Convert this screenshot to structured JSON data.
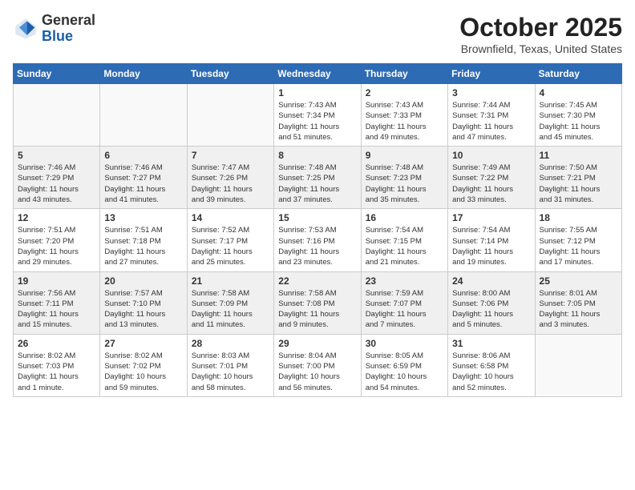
{
  "header": {
    "logo_general": "General",
    "logo_blue": "Blue",
    "month_title": "October 2025",
    "location": "Brownfield, Texas, United States"
  },
  "weekdays": [
    "Sunday",
    "Monday",
    "Tuesday",
    "Wednesday",
    "Thursday",
    "Friday",
    "Saturday"
  ],
  "weeks": [
    [
      {
        "day": null,
        "info": null
      },
      {
        "day": null,
        "info": null
      },
      {
        "day": null,
        "info": null
      },
      {
        "day": "1",
        "info": "Sunrise: 7:43 AM\nSunset: 7:34 PM\nDaylight: 11 hours\nand 51 minutes."
      },
      {
        "day": "2",
        "info": "Sunrise: 7:43 AM\nSunset: 7:33 PM\nDaylight: 11 hours\nand 49 minutes."
      },
      {
        "day": "3",
        "info": "Sunrise: 7:44 AM\nSunset: 7:31 PM\nDaylight: 11 hours\nand 47 minutes."
      },
      {
        "day": "4",
        "info": "Sunrise: 7:45 AM\nSunset: 7:30 PM\nDaylight: 11 hours\nand 45 minutes."
      }
    ],
    [
      {
        "day": "5",
        "info": "Sunrise: 7:46 AM\nSunset: 7:29 PM\nDaylight: 11 hours\nand 43 minutes."
      },
      {
        "day": "6",
        "info": "Sunrise: 7:46 AM\nSunset: 7:27 PM\nDaylight: 11 hours\nand 41 minutes."
      },
      {
        "day": "7",
        "info": "Sunrise: 7:47 AM\nSunset: 7:26 PM\nDaylight: 11 hours\nand 39 minutes."
      },
      {
        "day": "8",
        "info": "Sunrise: 7:48 AM\nSunset: 7:25 PM\nDaylight: 11 hours\nand 37 minutes."
      },
      {
        "day": "9",
        "info": "Sunrise: 7:48 AM\nSunset: 7:23 PM\nDaylight: 11 hours\nand 35 minutes."
      },
      {
        "day": "10",
        "info": "Sunrise: 7:49 AM\nSunset: 7:22 PM\nDaylight: 11 hours\nand 33 minutes."
      },
      {
        "day": "11",
        "info": "Sunrise: 7:50 AM\nSunset: 7:21 PM\nDaylight: 11 hours\nand 31 minutes."
      }
    ],
    [
      {
        "day": "12",
        "info": "Sunrise: 7:51 AM\nSunset: 7:20 PM\nDaylight: 11 hours\nand 29 minutes."
      },
      {
        "day": "13",
        "info": "Sunrise: 7:51 AM\nSunset: 7:18 PM\nDaylight: 11 hours\nand 27 minutes."
      },
      {
        "day": "14",
        "info": "Sunrise: 7:52 AM\nSunset: 7:17 PM\nDaylight: 11 hours\nand 25 minutes."
      },
      {
        "day": "15",
        "info": "Sunrise: 7:53 AM\nSunset: 7:16 PM\nDaylight: 11 hours\nand 23 minutes."
      },
      {
        "day": "16",
        "info": "Sunrise: 7:54 AM\nSunset: 7:15 PM\nDaylight: 11 hours\nand 21 minutes."
      },
      {
        "day": "17",
        "info": "Sunrise: 7:54 AM\nSunset: 7:14 PM\nDaylight: 11 hours\nand 19 minutes."
      },
      {
        "day": "18",
        "info": "Sunrise: 7:55 AM\nSunset: 7:12 PM\nDaylight: 11 hours\nand 17 minutes."
      }
    ],
    [
      {
        "day": "19",
        "info": "Sunrise: 7:56 AM\nSunset: 7:11 PM\nDaylight: 11 hours\nand 15 minutes."
      },
      {
        "day": "20",
        "info": "Sunrise: 7:57 AM\nSunset: 7:10 PM\nDaylight: 11 hours\nand 13 minutes."
      },
      {
        "day": "21",
        "info": "Sunrise: 7:58 AM\nSunset: 7:09 PM\nDaylight: 11 hours\nand 11 minutes."
      },
      {
        "day": "22",
        "info": "Sunrise: 7:58 AM\nSunset: 7:08 PM\nDaylight: 11 hours\nand 9 minutes."
      },
      {
        "day": "23",
        "info": "Sunrise: 7:59 AM\nSunset: 7:07 PM\nDaylight: 11 hours\nand 7 minutes."
      },
      {
        "day": "24",
        "info": "Sunrise: 8:00 AM\nSunset: 7:06 PM\nDaylight: 11 hours\nand 5 minutes."
      },
      {
        "day": "25",
        "info": "Sunrise: 8:01 AM\nSunset: 7:05 PM\nDaylight: 11 hours\nand 3 minutes."
      }
    ],
    [
      {
        "day": "26",
        "info": "Sunrise: 8:02 AM\nSunset: 7:03 PM\nDaylight: 11 hours\nand 1 minute."
      },
      {
        "day": "27",
        "info": "Sunrise: 8:02 AM\nSunset: 7:02 PM\nDaylight: 10 hours\nand 59 minutes."
      },
      {
        "day": "28",
        "info": "Sunrise: 8:03 AM\nSunset: 7:01 PM\nDaylight: 10 hours\nand 58 minutes."
      },
      {
        "day": "29",
        "info": "Sunrise: 8:04 AM\nSunset: 7:00 PM\nDaylight: 10 hours\nand 56 minutes."
      },
      {
        "day": "30",
        "info": "Sunrise: 8:05 AM\nSunset: 6:59 PM\nDaylight: 10 hours\nand 54 minutes."
      },
      {
        "day": "31",
        "info": "Sunrise: 8:06 AM\nSunset: 6:58 PM\nDaylight: 10 hours\nand 52 minutes."
      },
      {
        "day": null,
        "info": null
      }
    ]
  ]
}
